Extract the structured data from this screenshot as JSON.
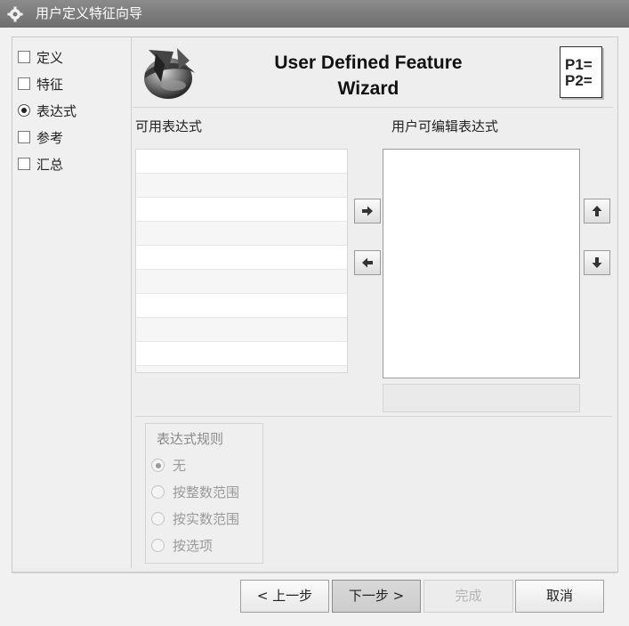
{
  "window": {
    "title": "用户定义特征向导"
  },
  "nav": {
    "items": [
      {
        "label": "定义",
        "control": "checkbox",
        "checked": false
      },
      {
        "label": "特征",
        "control": "checkbox",
        "checked": false
      },
      {
        "label": "表达式",
        "control": "radio",
        "checked": true
      },
      {
        "label": "参考",
        "control": "checkbox",
        "checked": false
      },
      {
        "label": "汇总",
        "control": "checkbox",
        "checked": false
      }
    ]
  },
  "header": {
    "title_line1": "User Defined Feature",
    "title_line2": "Wizard",
    "badge_line1": "P1=",
    "badge_line2": "P2="
  },
  "panels": {
    "available_label": "可用表达式",
    "editable_label": "用户可编辑表达式"
  },
  "rules": {
    "title": "表达式规则",
    "options": [
      {
        "label": "无",
        "selected": true
      },
      {
        "label": "按整数范围",
        "selected": false
      },
      {
        "label": "按实数范围",
        "selected": false
      },
      {
        "label": "按选项",
        "selected": false
      }
    ]
  },
  "footer": {
    "back": "< 上一步",
    "next": "下一步 >",
    "finish": "完成",
    "cancel": "取消"
  },
  "icons": {
    "title": "gear-icon",
    "logo": "udf-wizard-logo-icon",
    "move_right": "arrow-right-icon",
    "move_left": "arrow-left-icon",
    "move_up": "arrow-up-icon",
    "move_down": "arrow-down-icon"
  }
}
